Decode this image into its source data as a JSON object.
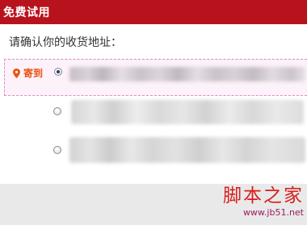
{
  "header": {
    "title": "免费试用"
  },
  "address_section": {
    "prompt": "请确认你的收货地址：",
    "ship_tag": "寄到",
    "options": [
      {
        "selected": true
      },
      {
        "selected": false
      },
      {
        "selected": false
      }
    ]
  },
  "watermark": {
    "title": "脚本之家",
    "url": "www.jb51.net"
  },
  "colors": {
    "header_bg": "#b8121d",
    "selected_row_bg": "#fdf1fa",
    "selected_row_border": "#e08ac6",
    "ship_tag": "#e8540f",
    "watermark": "#d81e1e"
  },
  "icons": {
    "ship_tag": "location-pin-icon"
  }
}
